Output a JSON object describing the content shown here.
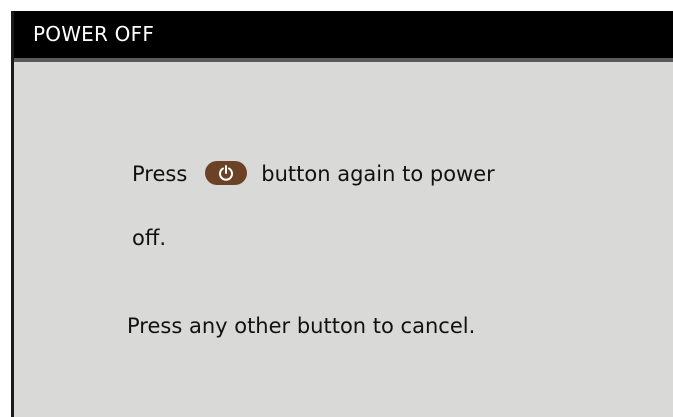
{
  "dialog": {
    "title": "POWER OFF",
    "message": {
      "line1_before": "Press",
      "button_icon": "power-icon",
      "line1_after": "button again to power",
      "line2": "off.",
      "line3": "Press any other button to cancel."
    }
  },
  "colors": {
    "title_bar": "#000000",
    "panel_background": "#d9d9d8",
    "power_button": "#6b4226",
    "text": "#111111"
  }
}
